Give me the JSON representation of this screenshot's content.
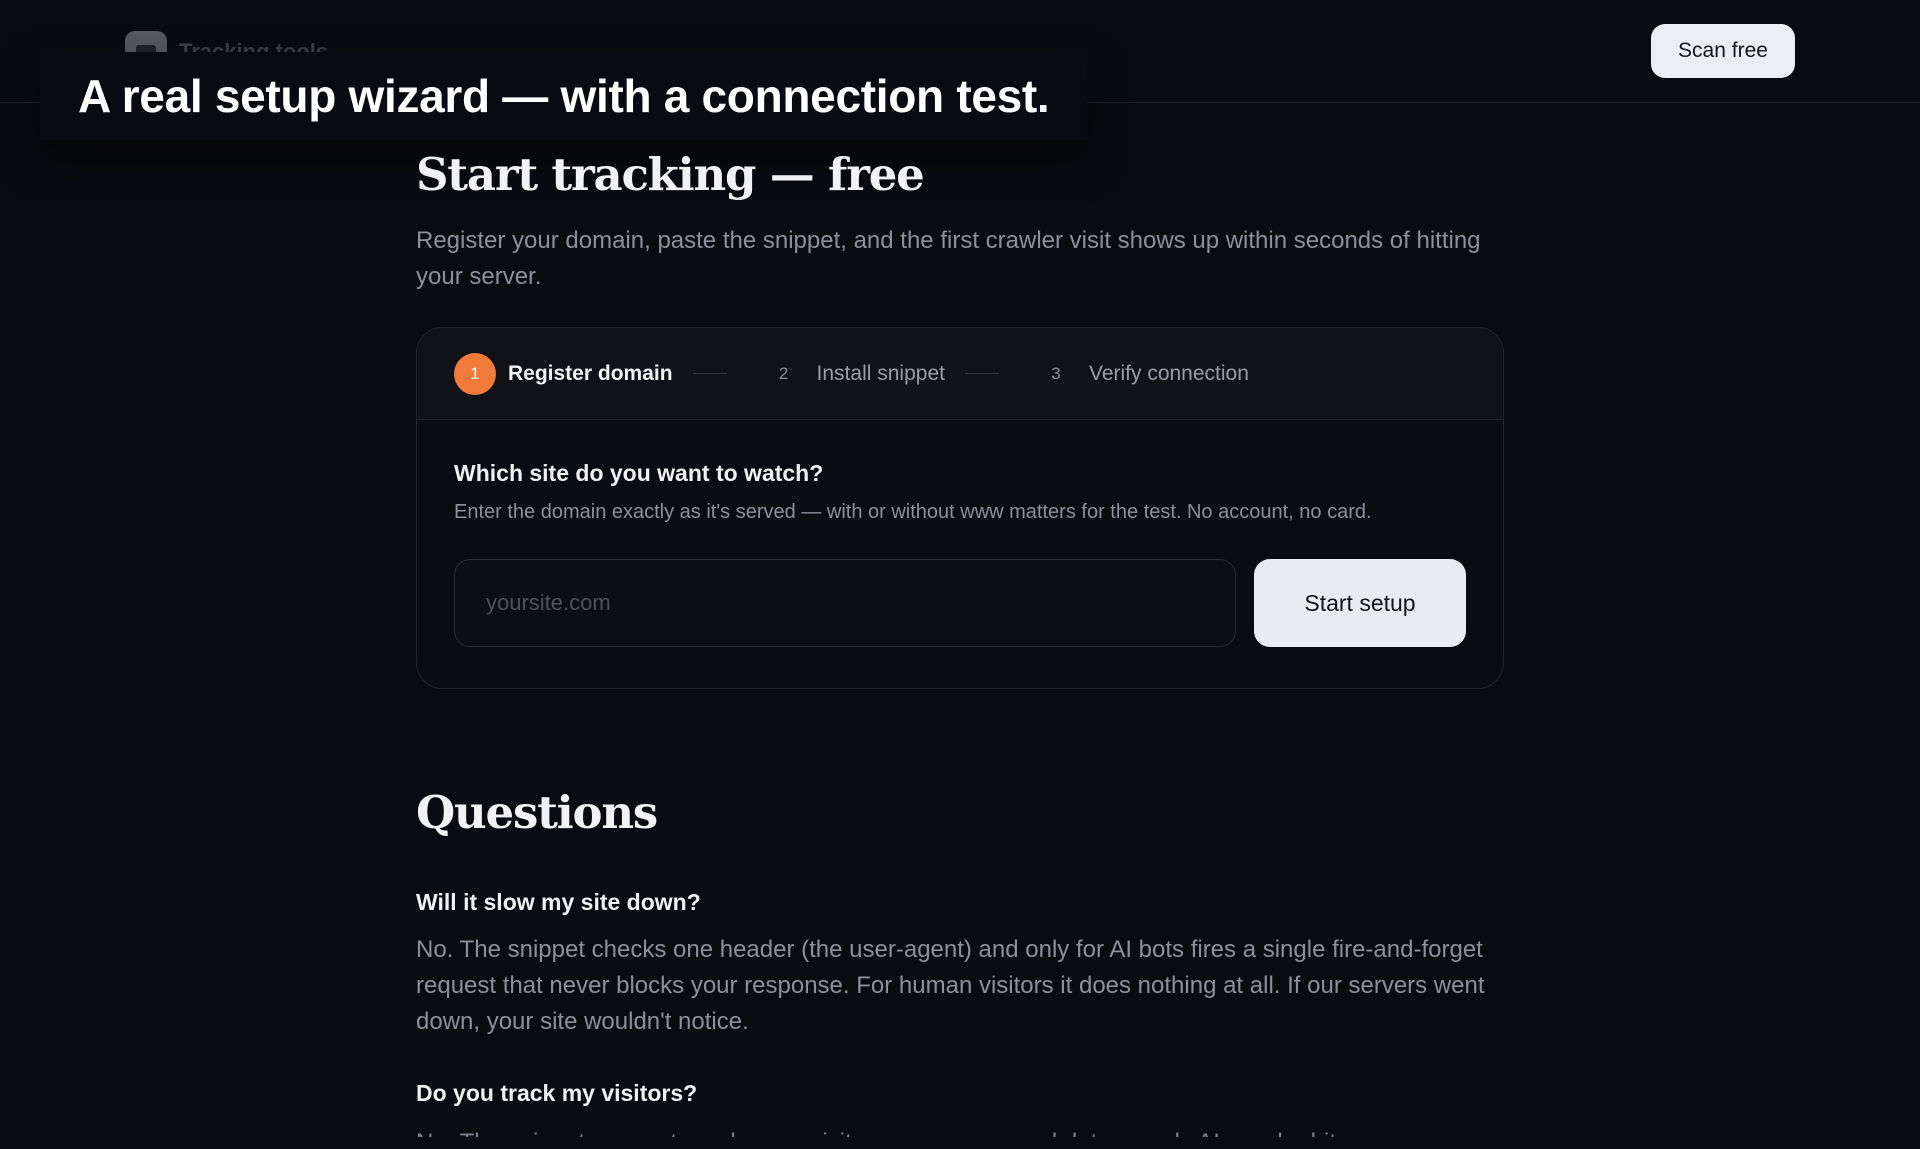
{
  "nav": {
    "brand": "Tracking.tools",
    "cta_label": "Scan free"
  },
  "caption": "A real setup wizard — with a connection test.",
  "hero": {
    "title": "Start tracking — free",
    "lead": "Register your domain, paste the snippet, and the first crawler visit shows up within seconds of hitting your server."
  },
  "wizard": {
    "steps": [
      {
        "number": "1",
        "label": "Register domain",
        "active": true
      },
      {
        "number": "2",
        "label": "Install snippet",
        "active": false
      },
      {
        "number": "3",
        "label": "Verify connection",
        "active": false
      }
    ],
    "question": "Which site do you want to watch?",
    "hint": "Enter the domain exactly as it's served — with or without www matters for the test. No account, no card.",
    "input": {
      "placeholder": "yoursite.com",
      "value": ""
    },
    "submit_label": "Start setup",
    "accent_color": "#f07a3a"
  },
  "faq": {
    "title": "Questions",
    "items": [
      {
        "question": "Will it slow my site down?",
        "answer": "No. The snippet checks one header (the user-agent) and only for AI bots fires a single fire-and-forget request that never blocks your response. For human visitors it does nothing at all. If our servers went down, your site wouldn't notice."
      },
      {
        "question": "Do you track my visitors?",
        "answer": "No. The snippet never stores human visitors or any personal data — only AI crawler hits."
      }
    ]
  }
}
